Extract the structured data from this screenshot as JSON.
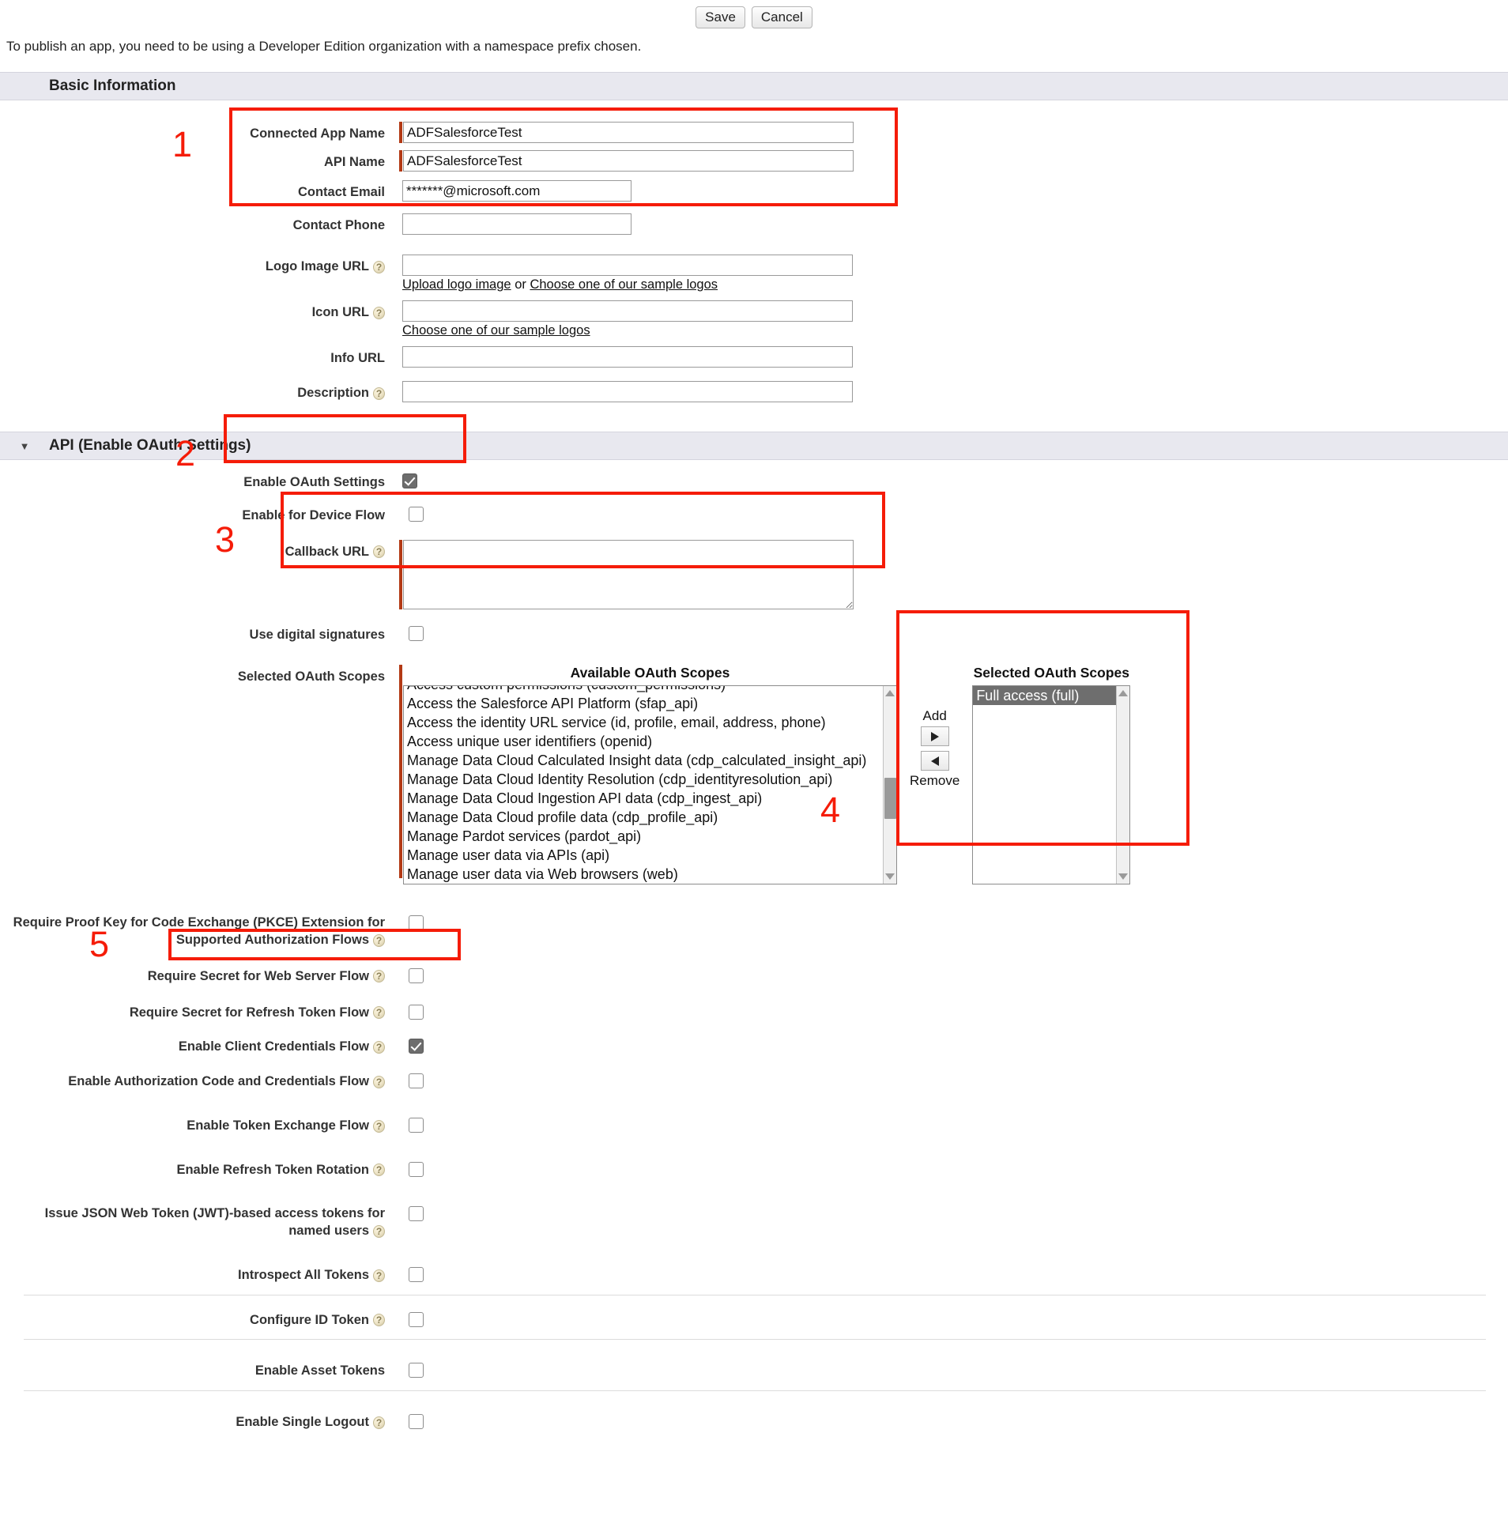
{
  "toolbar": {
    "save_label": "Save",
    "cancel_label": "Cancel"
  },
  "notice": "To publish an app, you need to be using a Developer Edition organization with a namespace prefix chosen.",
  "basic_information": {
    "section_title": "Basic Information",
    "fields": {
      "connected_app_name": {
        "label": "Connected App Name",
        "value": "ADFSalesforceTest",
        "required": true
      },
      "api_name": {
        "label": "API Name",
        "value": "ADFSalesforceTest",
        "required": true
      },
      "contact_email": {
        "label": "Contact Email",
        "value": "*******@microsoft.com",
        "required": false
      },
      "contact_phone": {
        "label": "Contact Phone",
        "value": ""
      },
      "logo_image_url": {
        "label": "Logo Image URL",
        "value": ""
      },
      "icon_url": {
        "label": "Icon URL",
        "value": ""
      },
      "info_url": {
        "label": "Info URL",
        "value": ""
      },
      "description": {
        "label": "Description",
        "value": ""
      }
    },
    "logo_links": {
      "upload": "Upload logo image",
      "or": "or",
      "sample": "Choose one of our sample logos"
    },
    "icon_links": {
      "sample": "Choose one of our sample logos"
    }
  },
  "api_section": {
    "section_title": "API (Enable OAuth Settings)",
    "twisty": "▼",
    "enable_oauth_settings": {
      "label": "Enable OAuth Settings",
      "checked": true
    },
    "enable_for_device_flow": {
      "label": "Enable for Device Flow",
      "checked": false
    },
    "callback_url": {
      "label": "Callback URL",
      "value": ""
    },
    "use_digital_signatures": {
      "label": "Use digital signatures",
      "checked": false
    },
    "selected_oauth_scopes_label": "Selected OAuth Scopes",
    "available_header": "Available OAuth Scopes",
    "selected_header": "Selected OAuth Scopes",
    "add_label": "Add",
    "remove_label": "Remove",
    "available_scopes": [
      "Access custom permissions (custom_permissions)",
      "Access the Salesforce API Platform (sfap_api)",
      "Access the identity URL service (id, profile, email, address, phone)",
      "Access unique user identifiers (openid)",
      "Manage Data Cloud Calculated Insight data (cdp_calculated_insight_api)",
      "Manage Data Cloud Identity Resolution (cdp_identityresolution_api)",
      "Manage Data Cloud Ingestion API data (cdp_ingest_api)",
      "Manage Data Cloud profile data (cdp_profile_api)",
      "Manage Pardot services (pardot_api)",
      "Manage user data via APIs (api)",
      "Manage user data via Web browsers (web)"
    ],
    "selected_scopes": [
      "Full access (full)"
    ],
    "flags": [
      {
        "label": "Require Proof Key for Code Exchange (PKCE) Extension for Supported Authorization Flows",
        "checked": false,
        "help": true,
        "multiline": true
      },
      {
        "label": "Require Secret for Web Server Flow",
        "checked": false,
        "help": true
      },
      {
        "label": "Require Secret for Refresh Token Flow",
        "checked": false,
        "help": true
      },
      {
        "label": "Enable Client Credentials Flow",
        "checked": true,
        "help": true
      },
      {
        "label": "Enable Authorization Code and Credentials Flow",
        "checked": false,
        "help": true
      },
      {
        "label": "Enable Token Exchange Flow",
        "checked": false,
        "help": true
      },
      {
        "label": "Enable Refresh Token Rotation",
        "checked": false,
        "help": true
      },
      {
        "label": "Issue JSON Web Token (JWT)-based access tokens for named users",
        "checked": false,
        "help": true,
        "multiline": true
      },
      {
        "label": "Introspect All Tokens",
        "checked": false,
        "help": true
      },
      {
        "label": "Configure ID Token",
        "checked": false,
        "help": true
      },
      {
        "label": "Enable Asset Tokens",
        "checked": false,
        "help": false
      },
      {
        "label": "Enable Single Logout",
        "checked": false,
        "help": true
      }
    ]
  },
  "annotations": [
    {
      "number": "1"
    },
    {
      "number": "2"
    },
    {
      "number": "3"
    },
    {
      "number": "4"
    },
    {
      "number": "5"
    }
  ]
}
